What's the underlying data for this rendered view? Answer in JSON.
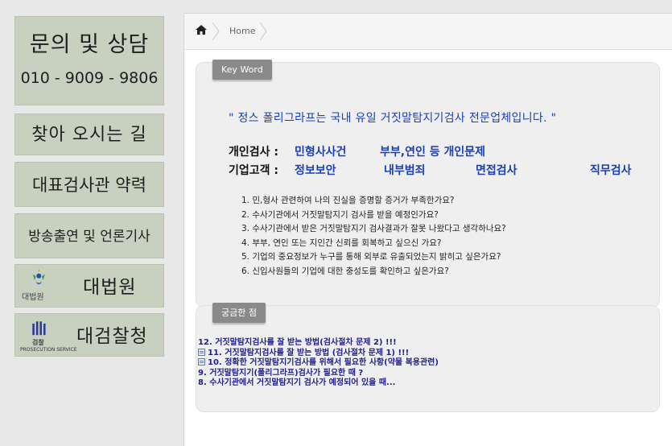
{
  "sidebar": {
    "contact_title": "문의 및 상담",
    "contact_phone": "010 - 9009 - 9806",
    "directions": "찾아 오시는 길",
    "examiner_profile": "대표검사관 약력",
    "media": "방송출연 및 언론기사",
    "court": {
      "label": "대법원",
      "logo_caption": "대법원",
      "icon": "supreme-court-logo"
    },
    "prosecutor": {
      "label": "대검찰청",
      "logo_caption": "검찰",
      "logo_sub": "PROSECUTION SERVICE",
      "icon": "prosecution-logo"
    },
    "colors": {
      "button_bg": "#c8d1c0"
    }
  },
  "breadcrumb": {
    "home_icon": "home-icon",
    "home_label": "Home"
  },
  "keyword": {
    "tag": "Key Word",
    "slogan": "\" 정스 폴리그라프는 국내 유일 거짓말탐지기검사 전문업체입니다. \"",
    "personal": {
      "label": "개인검사 :",
      "items": [
        "민형사사건",
        "부부,연인 등 개인문제"
      ]
    },
    "corporate": {
      "label": "기업고객 :",
      "items": [
        "정보보안",
        "내부범죄",
        "면접검사",
        "직무검사"
      ]
    },
    "questions": [
      "1. 민,형사 관련하여 나의 진실을 증명할 증거가 부족한가요?",
      "2. 수사기관에서 거짓말탐지기 검사를 받을 예정인가요?",
      "3. 수사기관에서 받은 거짓말탐지기 검사결과가 잘못 나왔다고 생각하나요?",
      "4. 부부, 연인 또는 지인간 신뢰를 회복하고 싶으신 가요?",
      "5. 기업의 중요정보가 누구를 통해 외부로 유출되었는지 밝히고 싶은가요?",
      "6. 신입사원들의 기업에 대한 충성도를 확인하고 싶은가요?"
    ],
    "colors": {
      "accent": "#1a3fb5"
    }
  },
  "faq": {
    "tag": "궁금한 점",
    "items": [
      {
        "text": "12. 거짓말탐지검사를 잘 받는 방법(검사절차 문제 2) !!!",
        "icon": ""
      },
      {
        "text": "11. 거짓말탐지검사를 잘 받는 방법 (검사절차 문제 1) !!!",
        "icon": "document-icon"
      },
      {
        "text": "10. 정확한 거짓말탐지기검사를 위해서 필요한 사항(약물 복용관련)",
        "icon": "document-icon"
      },
      {
        "text": "9. 거짓말탐지기(폴리그라프)검사가 필요한 때 ?",
        "icon": ""
      },
      {
        "text": "8. 수사기관에서 거짓말탐지기 검사가 예정되어 있을 때...",
        "icon": ""
      }
    ],
    "colors": {
      "link": "#1e1e8c"
    }
  }
}
